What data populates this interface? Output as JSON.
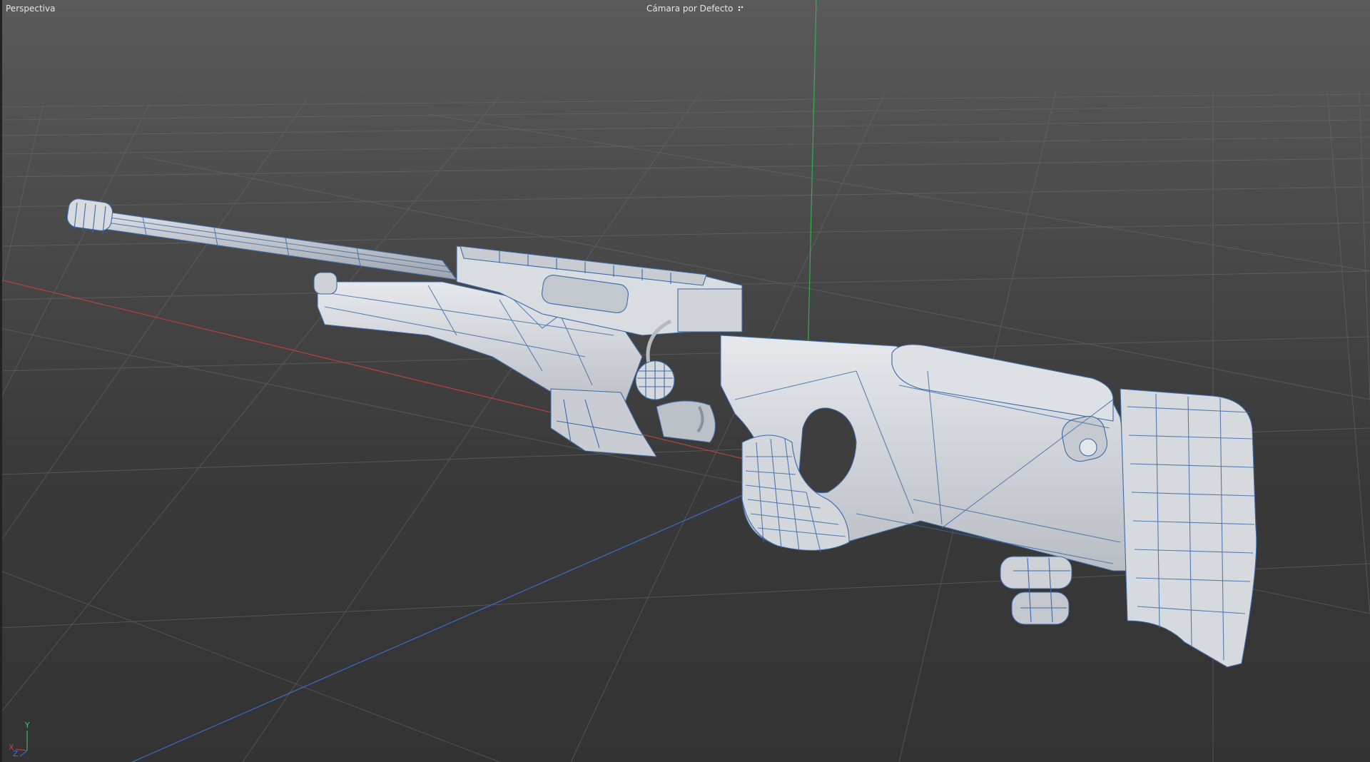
{
  "viewport": {
    "view_label": "Perspectiva",
    "camera_label": "Cámara por Defecto",
    "camera_icon": "camera-options-icon"
  },
  "axis_gizmo": {
    "x_label": "X",
    "y_label": "Y",
    "z_label": "Z",
    "x_color": "#d23c3c",
    "y_color": "#3cc86a",
    "z_color": "#3c78dc"
  },
  "scene": {
    "object": "sniper-rifle-wireframe-model",
    "grid": true,
    "colors": {
      "model_fill": "#d2d5da",
      "model_wire": "#3b6aa8",
      "grid_line": "#6a6a6a",
      "axis_x": "#b84040",
      "axis_y": "#30b050",
      "axis_z": "#3a6cc8"
    }
  }
}
